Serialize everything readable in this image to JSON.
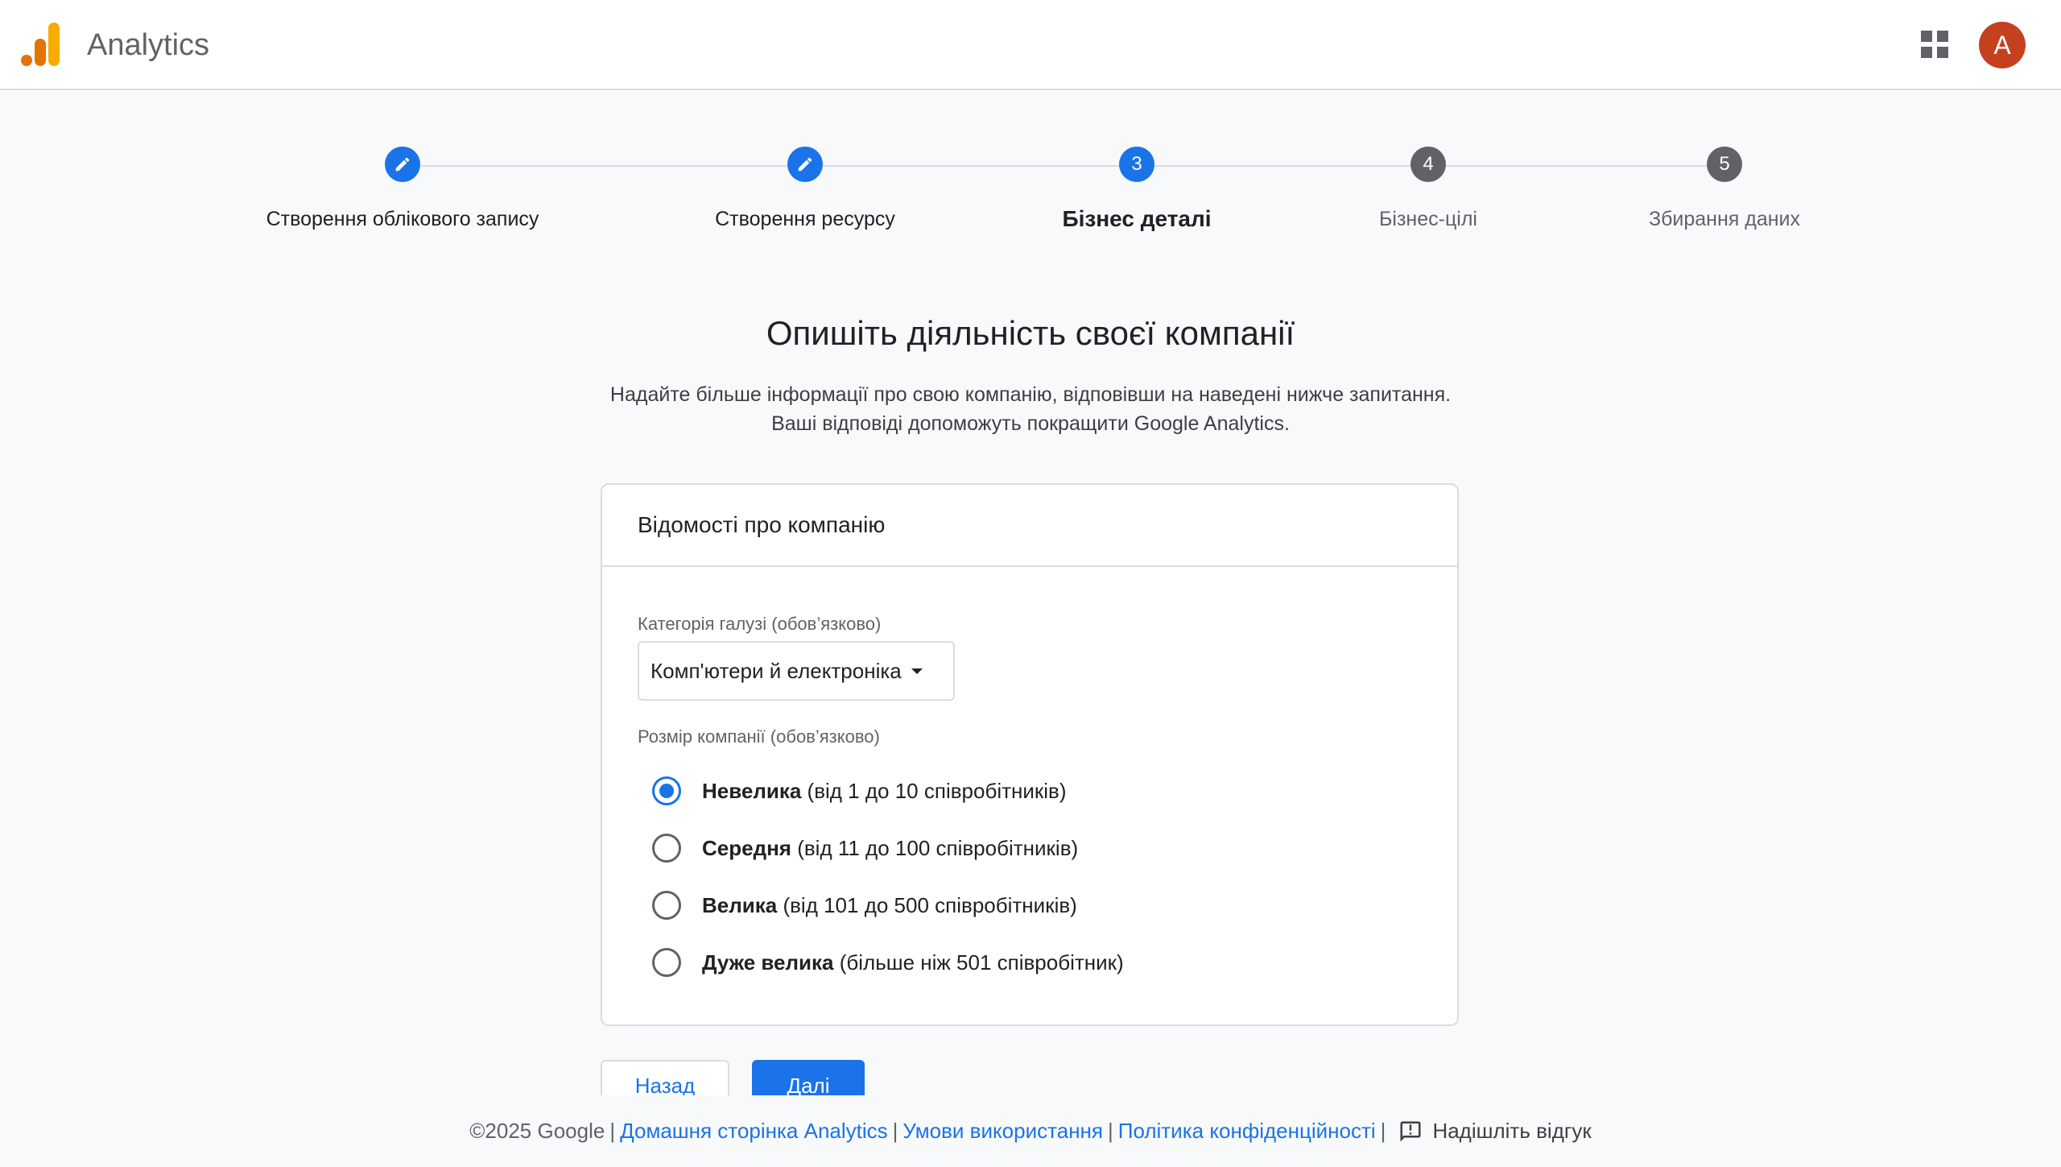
{
  "header": {
    "app_title": "Analytics",
    "avatar_letter": "A",
    "logo_colors": [
      "#f9ab00",
      "#e37400"
    ]
  },
  "stepper": {
    "steps": [
      {
        "label": "Створення облікового запису",
        "state": "done",
        "number": ""
      },
      {
        "label": "Створення ресурсу",
        "state": "done",
        "number": ""
      },
      {
        "label": "Бізнес деталі",
        "state": "active",
        "number": "3"
      },
      {
        "label": "Бізнес-цілі",
        "state": "pending",
        "number": "4"
      },
      {
        "label": "Збирання даних",
        "state": "pending",
        "number": "5"
      }
    ]
  },
  "main": {
    "title": "Опишіть діяльність своєї компанії",
    "description_line1": "Надайте більше інформації про свою компанію, відповівши на наведені нижче запитання.",
    "description_line2": "Ваші відповіді допоможуть покращити Google Analytics."
  },
  "card": {
    "header": "Відомості про компанію",
    "industry_label": "Категорія галузі (обов’язково)",
    "industry_value": "Комп'ютери й електроніка",
    "size_label": "Розмір компанії (обов’язково)",
    "size_options": [
      {
        "bold": "Невелика",
        "rest": " (від 1 до 10 співробітників)",
        "checked": true
      },
      {
        "bold": "Середня",
        "rest": " (від 11 до 100 співробітників)",
        "checked": false
      },
      {
        "bold": "Велика",
        "rest": " (від 101 до 500 співробітників)",
        "checked": false
      },
      {
        "bold": "Дуже велика",
        "rest": " (більше ніж 501 співробітник)",
        "checked": false
      }
    ]
  },
  "buttons": {
    "back": "Назад",
    "next": "Далі"
  },
  "footer": {
    "copyright": "©2025 Google",
    "sep": "|",
    "links": [
      "Домашня сторінка Analytics",
      "Умови використання",
      "Політика конфіденційності"
    ],
    "feedback": "Надішліть відгук"
  },
  "colors": {
    "accent": "#1a73e8",
    "avatar": "#c5401f",
    "pending_step": "#5f6368"
  }
}
